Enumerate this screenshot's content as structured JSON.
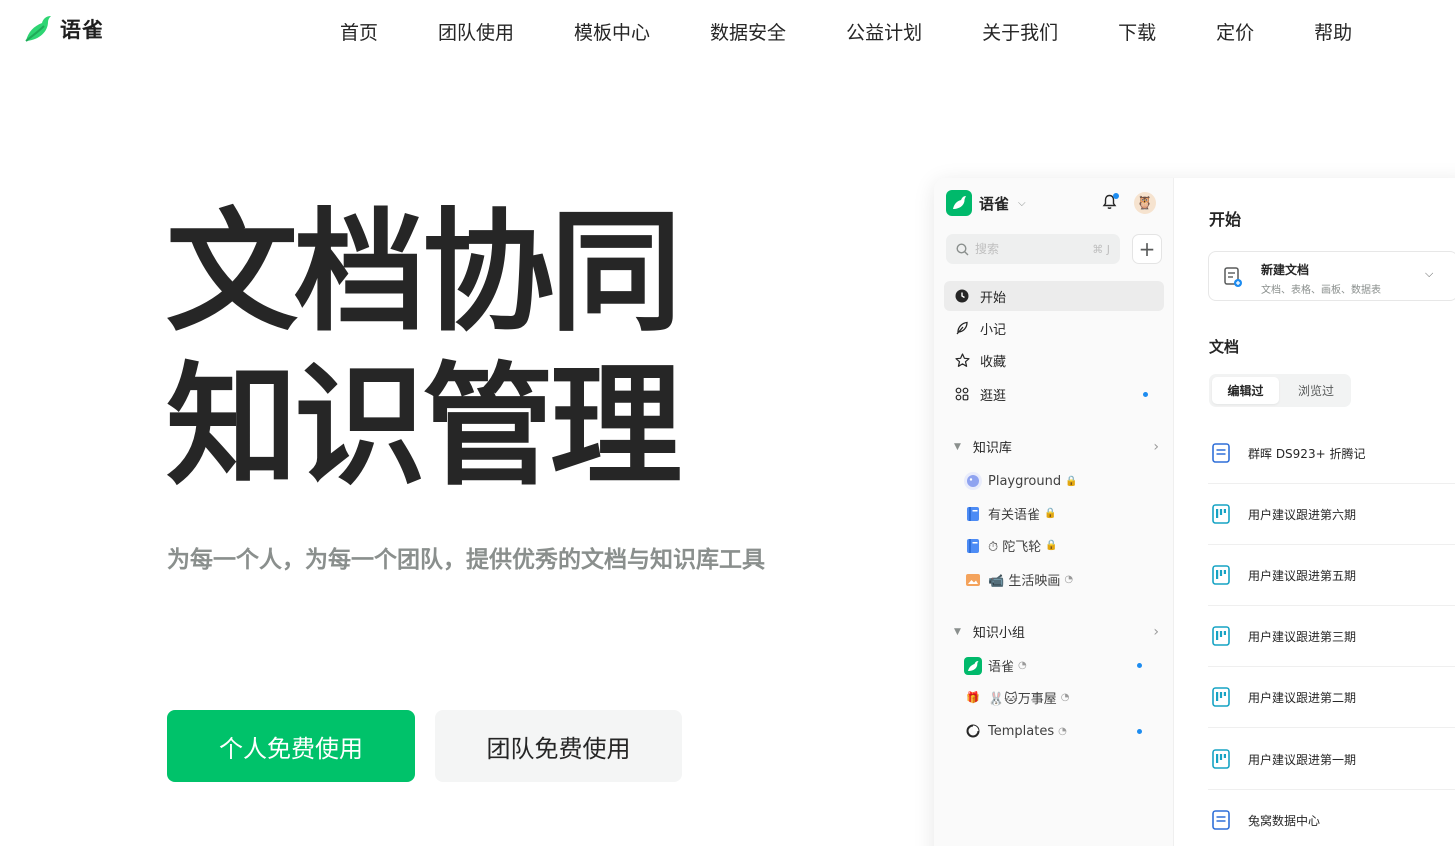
{
  "brand": {
    "name": "语雀"
  },
  "nav": {
    "items": [
      "首页",
      "团队使用",
      "模板中心",
      "数据安全",
      "公益计划",
      "关于我们",
      "下载",
      "定价",
      "帮助"
    ]
  },
  "hero": {
    "title_line1": "文档协同",
    "title_line2": "知识管理",
    "subtitle": "为每一个人，为每一个团队，提供优秀的文档与知识库工具",
    "primary_button": "个人免费使用",
    "secondary_button": "团队免费使用"
  },
  "app": {
    "brand": "语雀",
    "search": {
      "placeholder": "搜索",
      "shortcut": "⌘ J"
    },
    "menu": [
      {
        "label": "开始",
        "icon": "clock-icon",
        "active": true
      },
      {
        "label": "小记",
        "icon": "feather-icon"
      },
      {
        "label": "收藏",
        "icon": "star-icon"
      },
      {
        "label": "逛逛",
        "icon": "grid-icon",
        "dot": true
      }
    ],
    "knowledge_base": {
      "title": "知识库",
      "items": [
        {
          "label": "Playground"
        },
        {
          "label": "有关语雀"
        },
        {
          "label": "⏱ 陀飞轮"
        },
        {
          "label": "📹 生活映画"
        }
      ]
    },
    "groups": {
      "title": "知识小组",
      "items": [
        {
          "label": "语雀"
        },
        {
          "label": "🐰🐱万事屋"
        },
        {
          "label": "Templates"
        }
      ]
    },
    "main": {
      "heading": "开始",
      "new_doc": {
        "title": "新建文档",
        "subtitle": "文档、表格、画板、数据表"
      },
      "docs_heading": "文档",
      "tabs": [
        "编辑过",
        "浏览过"
      ],
      "docs": [
        {
          "title": "群晖 DS923+ 折腾记",
          "icon": "doc-icon"
        },
        {
          "title": "用户建议跟进第六期",
          "icon": "board-icon"
        },
        {
          "title": "用户建议跟进第五期",
          "icon": "board-icon"
        },
        {
          "title": "用户建议跟进第三期",
          "icon": "board-icon"
        },
        {
          "title": "用户建议跟进第二期",
          "icon": "board-icon"
        },
        {
          "title": "用户建议跟进第一期",
          "icon": "board-icon"
        },
        {
          "title": "兔窝数据中心",
          "icon": "doc-icon"
        }
      ]
    }
  },
  "colors": {
    "accent": "#00c26a",
    "dot": "#1d8cf0",
    "text": "#262626",
    "muted": "#8a8f8d"
  }
}
